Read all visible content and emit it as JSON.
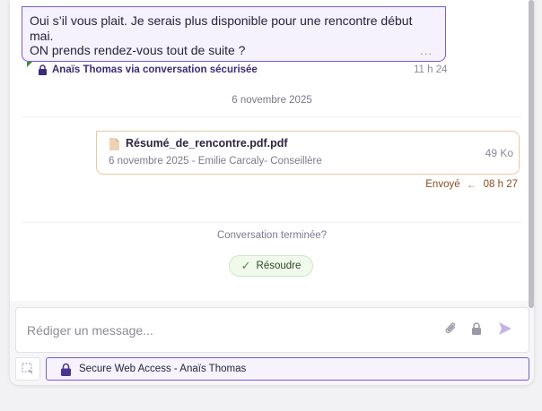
{
  "incoming": {
    "line1": "Oui s’il vous plait. Je serais plus disponible pour une rencontre début mai.",
    "line2": "ON prends rendez-vous tout de suite ?",
    "more": "...",
    "sender": "Anaïs Thomas via conversation sécurisée",
    "time": "11 h 24"
  },
  "date_separator": "6 novembre 2025",
  "outgoing": {
    "file_name": "Résumé_de_rencontre.pdf.pdf",
    "file_size": "49 Ko",
    "file_sub": "6 novembre 2025 - Emilie Carcaly- Conseillère",
    "status": "Envoyé",
    "time": "08 h 27"
  },
  "conversation_end": {
    "question": "Conversation terminée?",
    "resolve_label": "Résoudre"
  },
  "composer": {
    "placeholder": "Rédiger un message...",
    "icons": [
      "paperclip-icon",
      "lock-icon",
      "send-icon"
    ]
  },
  "bottom_bar": {
    "secure_label": "Secure Web Access - Anaïs Thomas",
    "icons": [
      "selection-icon",
      "lock-icon"
    ]
  },
  "colors": {
    "accent_purple": "#7c5cc9",
    "lock_purple": "#4a3590",
    "file_border": "#e9c9a1",
    "sent_status": "#8a4b1c",
    "resolve_bg": "#f1f9ec"
  }
}
